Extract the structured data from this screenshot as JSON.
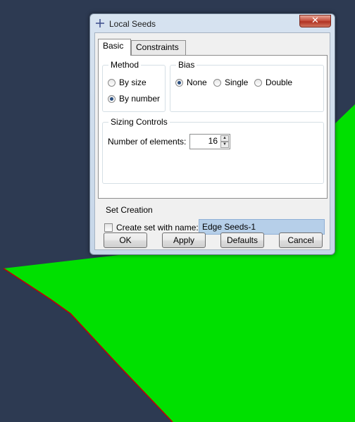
{
  "dialog": {
    "title": "Local Seeds",
    "close_symbol": "✕"
  },
  "tabs": [
    {
      "label": "Basic"
    },
    {
      "label": "Constraints"
    }
  ],
  "method": {
    "legend": "Method",
    "options": [
      {
        "label": "By size"
      },
      {
        "label": "By number"
      }
    ],
    "selected": "By number"
  },
  "bias": {
    "legend": "Bias",
    "options": [
      {
        "label": "None"
      },
      {
        "label": "Single"
      },
      {
        "label": "Double"
      }
    ],
    "selected": "None"
  },
  "sizing": {
    "legend": "Sizing Controls",
    "num_elements_label": "Number of elements:",
    "num_elements_value": "16"
  },
  "set_creation": {
    "legend": "Set Creation",
    "checkbox_label": "Create set with name:",
    "checked": false,
    "set_name": "Edge Seeds-1"
  },
  "buttons": {
    "ok": "OK",
    "apply": "Apply",
    "defaults": "Defaults",
    "cancel": "Cancel"
  },
  "viewport": {
    "background_color": "#2d3a52",
    "face_color": "#00e000",
    "edge_color": "#c40000"
  }
}
